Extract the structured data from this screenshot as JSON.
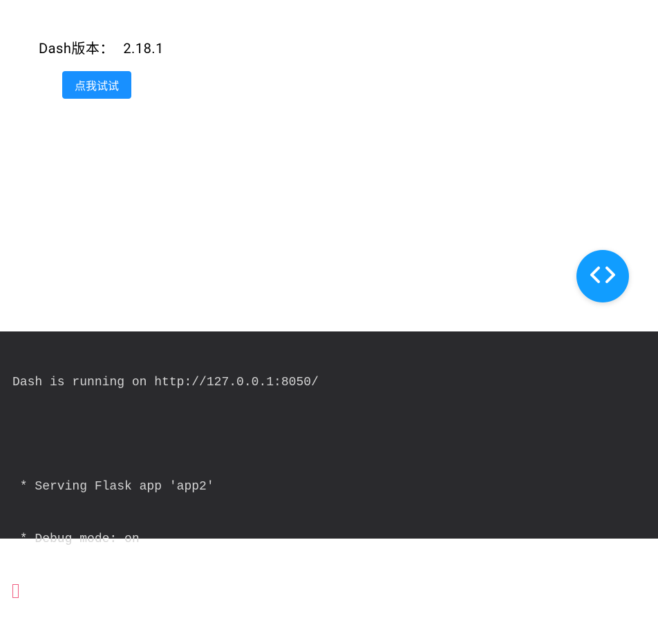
{
  "app": {
    "version_label": "Dash版本：",
    "version_value": "2.18.1",
    "button_label": "点我试试"
  },
  "devtools": {
    "icon_name": "code-angle-brackets"
  },
  "terminal": {
    "line1": "Dash is running on http://127.0.0.1:8050/",
    "line2": " * Serving Flask app 'app2'",
    "line3": " * Debug mode: on"
  }
}
